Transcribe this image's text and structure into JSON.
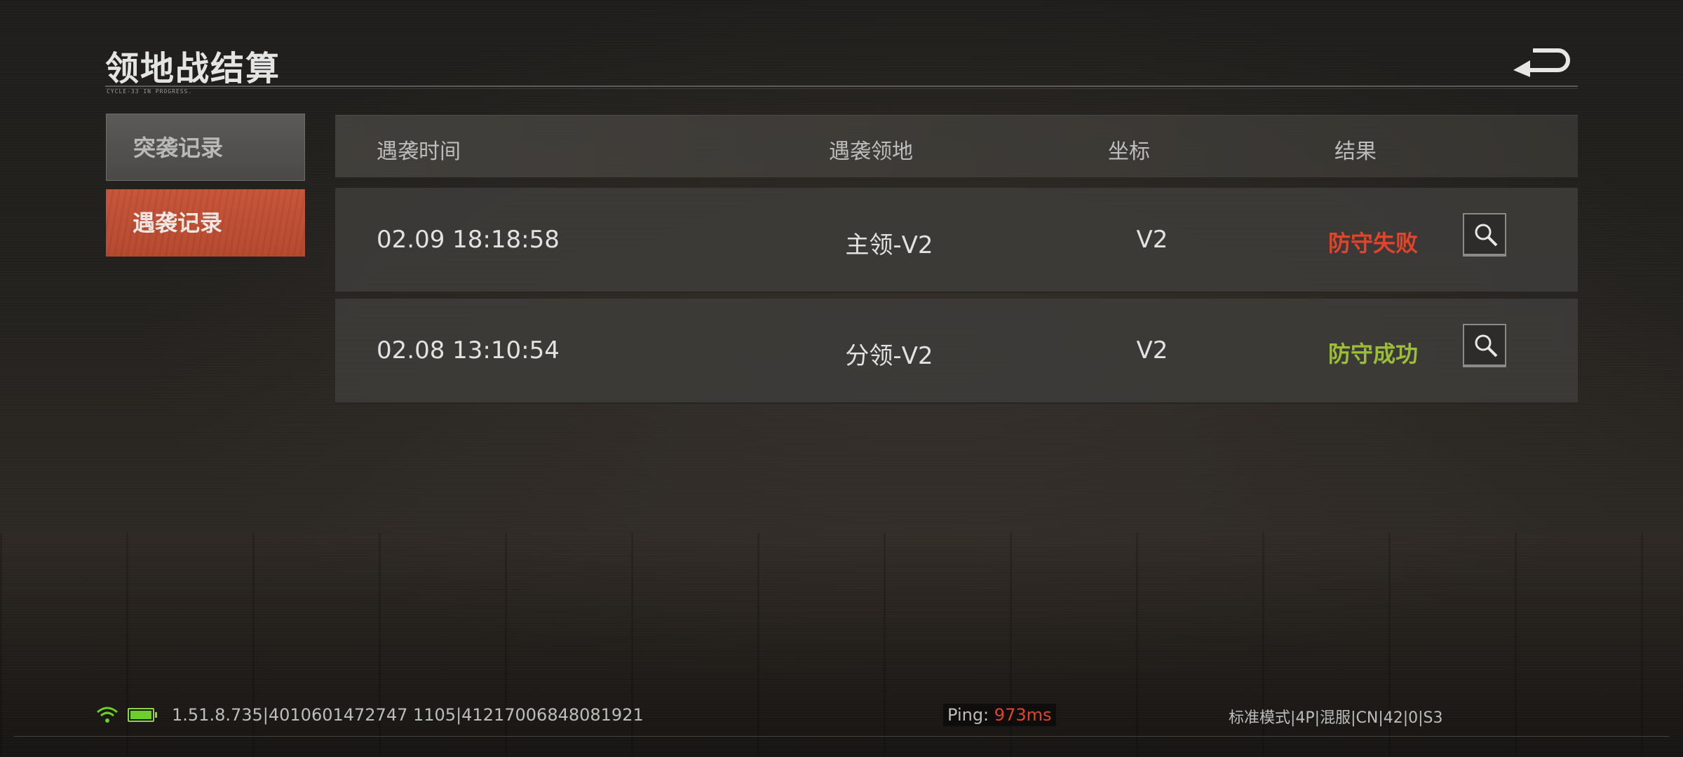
{
  "header": {
    "title": "领地战结算",
    "subtitle": "CYCLE-33 IN PROGRESS."
  },
  "sidebar": {
    "items": [
      {
        "label": "突袭记录",
        "state": "inactive"
      },
      {
        "label": "遇袭记录",
        "state": "active"
      }
    ]
  },
  "table": {
    "columns": [
      "遇袭时间",
      "遇袭领地",
      "坐标",
      "结果"
    ],
    "rows": [
      {
        "time": "02.09 18:18:58",
        "territory": "主领-V2",
        "coord": "V2",
        "result": "防守失败",
        "result_type": "fail"
      },
      {
        "time": "02.08 13:10:54",
        "territory": "分领-V2",
        "coord": "V2",
        "result": "防守成功",
        "result_type": "success"
      }
    ]
  },
  "status_bar": {
    "version": "1.51.8.735|4010601472747 1105|41217006848081921",
    "ping_label": "Ping:",
    "ping_value": "973ms",
    "mode": "标准模式|4P|混服|CN|42|0|S3"
  },
  "colors": {
    "accent": "#c8563a",
    "fail": "#e0452c",
    "success": "#9bbd3a"
  },
  "icons": [
    "back-arrow-icon",
    "search-icon",
    "wifi-icon",
    "battery-icon"
  ]
}
